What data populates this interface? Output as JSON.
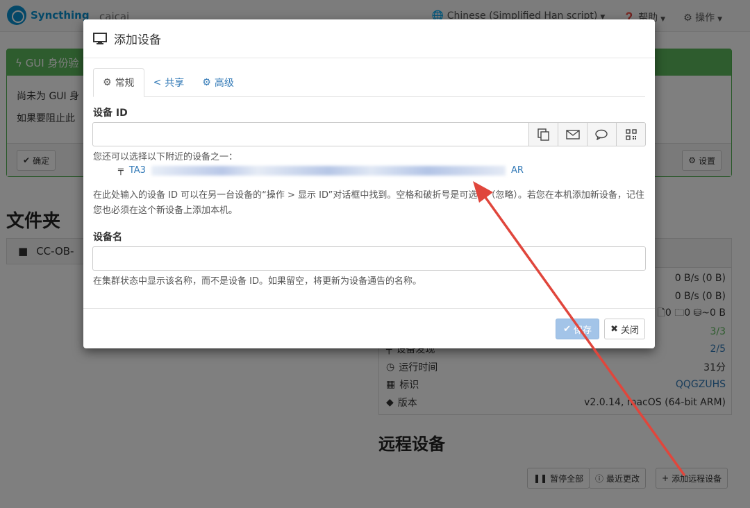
{
  "navbar": {
    "brand": "Syncthing",
    "hostname": "caicai",
    "language": "Chinese (Simplified Han script)",
    "help": "帮助",
    "actions": "操作"
  },
  "gui_panel": {
    "title": "GUI 身份验",
    "line1": "尚未为 GUI 身",
    "line2": "如果要阻止此",
    "confirm": "确定",
    "settings": "设置"
  },
  "folders": {
    "heading": "文件夹",
    "first": "CC-OB-"
  },
  "this_device": {
    "rows": [
      {
        "label": "",
        "value": "0 B/s (0 B)"
      },
      {
        "label": "",
        "value": "0 B/s (0 B)"
      },
      {
        "label": "",
        "value": "🗋0  🗀0  ⛁~0 B"
      },
      {
        "label": "",
        "value": "3/3"
      },
      {
        "label": "设备发现",
        "value": "2/5"
      },
      {
        "label": "运行时间",
        "value": "31分"
      },
      {
        "label": "标识",
        "value": "QQGZUHS"
      },
      {
        "label": "版本",
        "value": "v2.0.14, macOS (64-bit ARM)"
      }
    ]
  },
  "remote": {
    "heading": "远程设备",
    "pause_all": "暂停全部",
    "recent_changes": "最近更改",
    "add_remote": "添加远程设备"
  },
  "modal": {
    "title": "添加设备",
    "tabs": [
      {
        "label": "常规"
      },
      {
        "label": "共享"
      },
      {
        "label": "高级"
      }
    ],
    "device_id_label": "设备 ID",
    "device_id_value": "",
    "nearby_hint": "您还可以选择以下附近的设备之一：",
    "nearby_prefix": "TA3",
    "nearby_suffix": "AR",
    "id_help": "在此处输入的设备 ID 可以在另一台设备的“操作 > 显示 ID”对话框中找到。空格和破折号是可选的（忽略）。若您在本机添加新设备，记住您也必须在这个新设备上添加本机。",
    "name_label": "设备名",
    "name_value": "",
    "name_help": "在集群状态中显示该名称，而不是设备 ID。如果留空，将更新为设备通告的名称。",
    "save": "保存",
    "close": "关闭"
  },
  "colors": {
    "brand": "#0891d1",
    "success": "#5cb85c",
    "link": "#337ab7",
    "annotation_arrow": "#e0463c"
  }
}
